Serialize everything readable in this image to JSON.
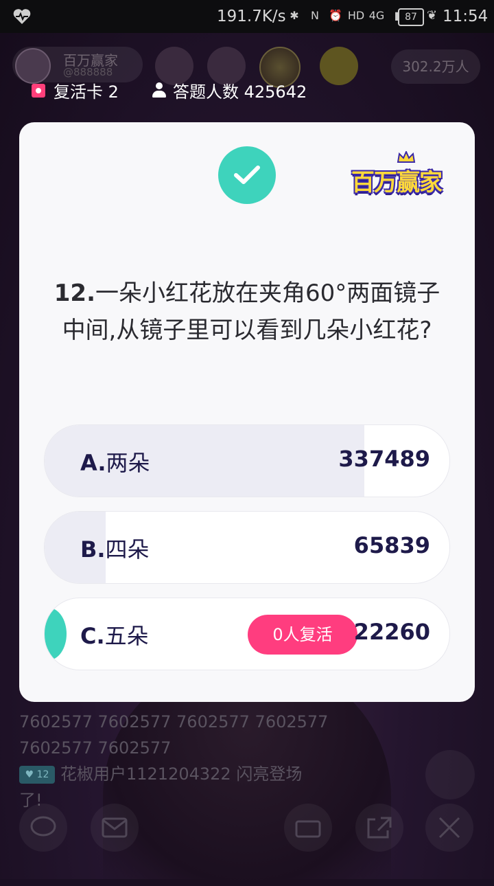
{
  "status_bar": {
    "speed": "191.7K/s",
    "network": "4G",
    "battery": "87",
    "time": "11:54"
  },
  "live_room": {
    "host_name": "百万赢家",
    "host_id": "@888888",
    "viewers": "302.2万人"
  },
  "game_status": {
    "revive_cards": "复活卡 2",
    "answer_count": "答题人数 425642"
  },
  "quiz": {
    "logo_text": "百万赢家",
    "question_number": "12.",
    "question_text": "一朵小红花放在夹角60°两面镜子中间,从镜子里可以看到几朵小红花?",
    "options": [
      {
        "letter": "A.",
        "text": "两朵",
        "count": "337489",
        "fraction": 0.79,
        "correct": false
      },
      {
        "letter": "B.",
        "text": "四朵",
        "count": "65839",
        "fraction": 0.15,
        "correct": false
      },
      {
        "letter": "C.",
        "text": "五朵",
        "count": "22260",
        "fraction": 0.0,
        "correct": true,
        "revive_badge": "0人复活"
      }
    ]
  },
  "chat": {
    "line1": "7602577 7602577 7602577 7602577",
    "line2": "7602577 7602577",
    "badge": "12",
    "user_line": "花椒用户1121204322 闪亮登场",
    "user_line_end": "了!"
  },
  "colors": {
    "correct": "#3ed3bc",
    "revive_badge": "#ff3d7f",
    "option_text": "#1e1a4a"
  }
}
